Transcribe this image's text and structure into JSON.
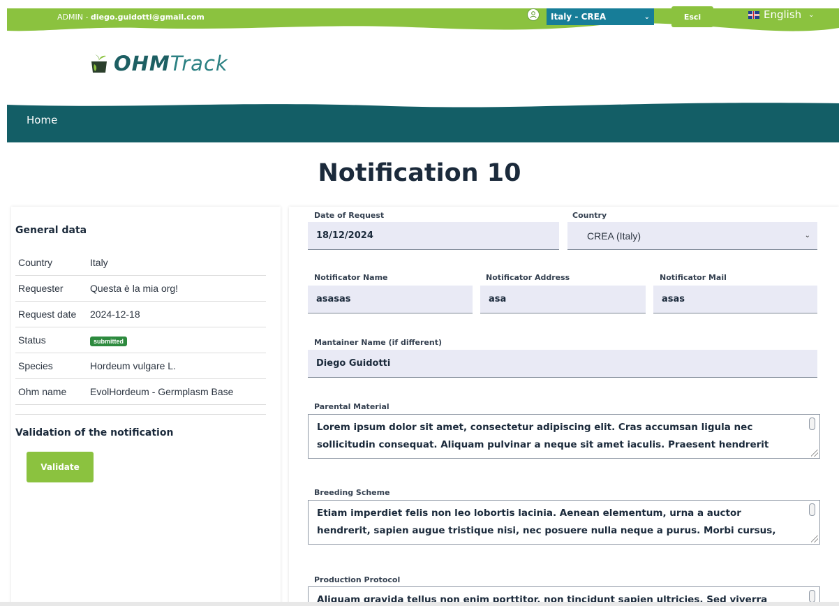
{
  "header": {
    "admin_prefix": "ADMIN - ",
    "admin_email": "diego.guidotti@gmail.com",
    "org_select": "Italy - CREA",
    "logout_label": "Esci",
    "language": "English",
    "logo_bold": "OHM",
    "logo_light": "Track"
  },
  "nav": {
    "home": "Home"
  },
  "page": {
    "title": "Notification 10"
  },
  "general": {
    "title": "General data",
    "rows": [
      {
        "label": "Country",
        "value": "Italy"
      },
      {
        "label": "Requester",
        "value": "Questa è la mia org!"
      },
      {
        "label": "Request date",
        "value": "2024-12-18"
      },
      {
        "label": "Status",
        "value": "submitted"
      },
      {
        "label": "Species",
        "value": "Hordeum vulgare L."
      },
      {
        "label": "Ohm name",
        "value": "EvolHordeum - Germplasm Base"
      }
    ],
    "validation_title": "Validation of the notification",
    "validate_label": "Validate"
  },
  "form": {
    "date_label": "Date of Request",
    "date_value": "18/12/2024",
    "country_label": "Country",
    "country_value": "CREA (Italy)",
    "notif_name_label": "Notificator Name",
    "notif_name_value": "asasas",
    "notif_address_label": "Notificator Address",
    "notif_address_value": "asa",
    "notif_mail_label": "Notificator Mail",
    "notif_mail_value": "asas",
    "maintainer_label": "Mantainer Name (if different)",
    "maintainer_value": "Diego Guidotti",
    "parental_label": "Parental Material",
    "parental_value": "Lorem ipsum dolor sit amet, consectetur adipiscing elit. Cras accumsan ligula nec sollicitudin consequat. Aliquam pulvinar a neque sit amet iaculis. Praesent hendrerit lacus non lorem iaculis,",
    "breeding_label": "Breeding Scheme",
    "breeding_value": "Etiam imperdiet felis non leo lobortis lacinia. Aenean elementum, urna a auctor hendrerit, sapien augue tristique nisi, nec posuere nulla neque a purus. Morbi cursus, tortor aliquam faucibus",
    "protocol_label": "Production Protocol",
    "protocol_value": "Aliquam gravida tellus non enim porttitor, non tincidunt sapien ultricies. Sed viverra purus id"
  },
  "colors": {
    "green": "#8bc23f",
    "teal": "#135e66",
    "org_select_bg": "#177d98",
    "input_bg": "#e9eaf5",
    "badge": "#2d8a3e"
  }
}
